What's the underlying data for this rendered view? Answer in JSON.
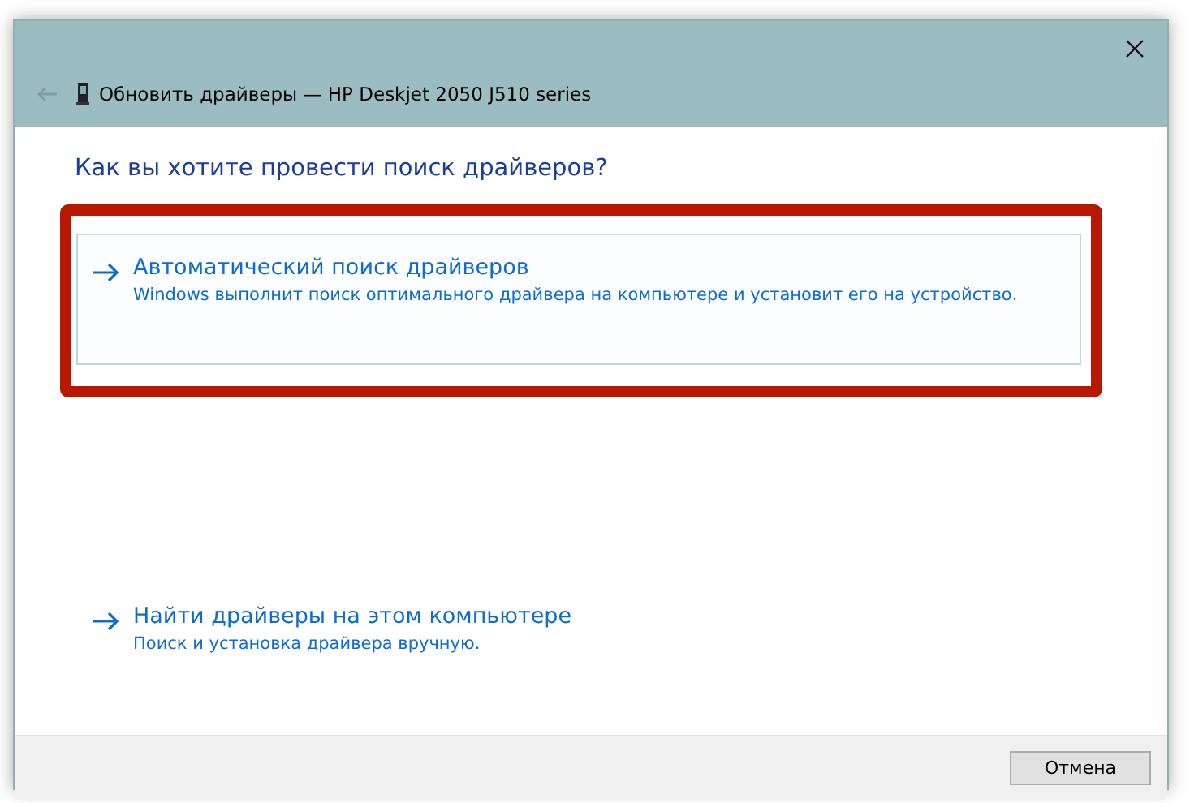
{
  "window": {
    "title": "Обновить драйверы — HP Deskjet 2050 J510 series"
  },
  "heading": "Как вы хотите провести поиск драйверов?",
  "options": [
    {
      "title": "Автоматический поиск драйверов",
      "description": "Windows выполнит поиск оптимального драйвера на компьютере и установит его на устройство.",
      "selected": true,
      "highlighted": true
    },
    {
      "title": "Найти драйверы на этом компьютере",
      "description": "Поиск и установка драйвера вручную.",
      "selected": false,
      "highlighted": false
    }
  ],
  "buttons": [
    "Отмена"
  ]
}
